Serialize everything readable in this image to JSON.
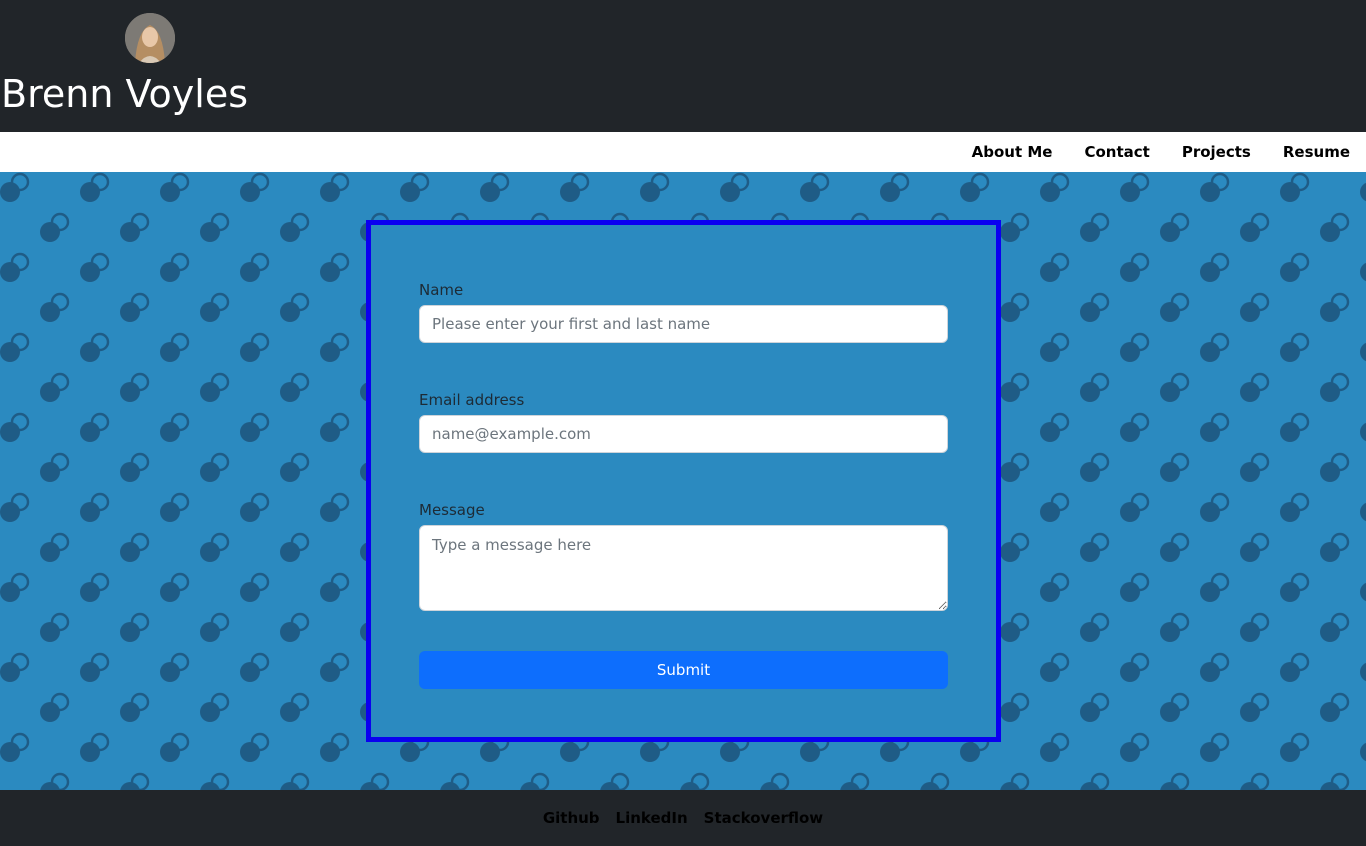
{
  "header": {
    "site_title": "Brenn Voyles"
  },
  "nav": {
    "items": [
      {
        "label": "About Me"
      },
      {
        "label": "Contact"
      },
      {
        "label": "Projects"
      },
      {
        "label": "Resume"
      }
    ]
  },
  "form": {
    "name": {
      "label": "Name",
      "placeholder": "Please enter your first and last name"
    },
    "email": {
      "label": "Email address",
      "placeholder": "name@example.com"
    },
    "message": {
      "label": "Message",
      "placeholder": "Type a message here"
    },
    "submit_label": "Submit"
  },
  "footer": {
    "links": [
      {
        "label": "Github"
      },
      {
        "label": "LinkedIn"
      },
      {
        "label": "Stackoverflow"
      }
    ]
  },
  "colors": {
    "header_bg": "#212529",
    "pattern_bg": "#2b8ac0",
    "pattern_dot": "#1f5c86",
    "form_border": "#0a00f0",
    "submit_bg": "#0d6efd"
  }
}
